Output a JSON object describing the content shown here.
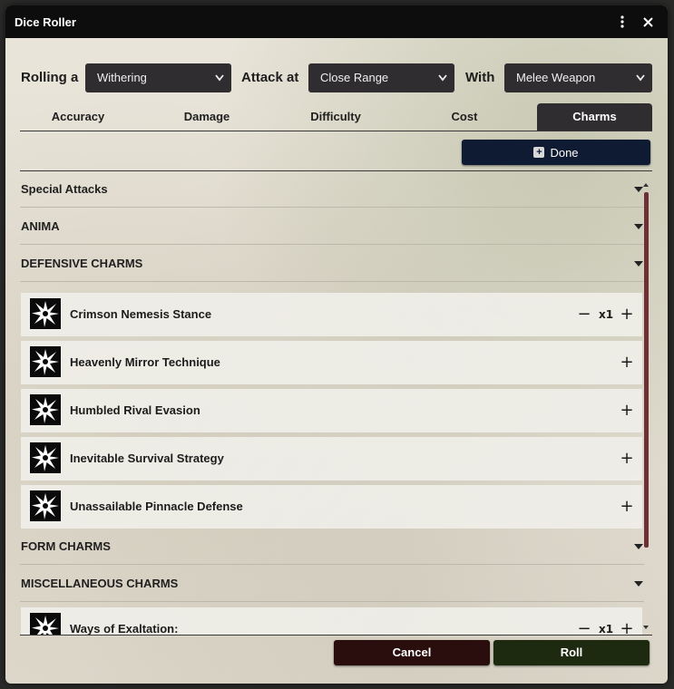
{
  "window": {
    "title": "Dice Roller"
  },
  "roll_row": {
    "rolling_label": "Rolling a",
    "rolling_value": "Withering",
    "attack_label": "Attack at",
    "attack_value": "Close Range",
    "with_label": "With",
    "with_value": "Melee Weapon"
  },
  "tabs": [
    {
      "label": "Accuracy",
      "active": false
    },
    {
      "label": "Damage",
      "active": false
    },
    {
      "label": "Difficulty",
      "active": false
    },
    {
      "label": "Cost",
      "active": false
    },
    {
      "label": "Charms",
      "active": true
    }
  ],
  "done_label": "Done",
  "sections": [
    {
      "label": "Special Attacks"
    },
    {
      "label": "ANIMA"
    },
    {
      "label": "DEFENSIVE CHARMS"
    },
    {
      "label": "FORM CHARMS"
    },
    {
      "label": "MISCELLANEOUS CHARMS"
    }
  ],
  "charms": [
    {
      "name": "Crimson Nemesis Stance",
      "qty": "x1",
      "minus": "−",
      "plus": "+"
    },
    {
      "name": "Heavenly Mirror Technique",
      "plus": "+"
    },
    {
      "name": "Humbled Rival Evasion",
      "plus": "+"
    },
    {
      "name": "Inevitable Survival Strategy",
      "plus": "+"
    },
    {
      "name": "Unassailable Pinnacle Defense",
      "plus": "+"
    },
    {
      "name": "Ways of Exaltation:",
      "qty": "x1",
      "minus": "−",
      "plus": "+"
    }
  ],
  "footer": {
    "cancel_label": "Cancel",
    "roll_label": "Roll"
  },
  "colors": {
    "dark": "#2f2d30",
    "done": "#0f1a33",
    "cancel": "#2a0e0e",
    "roll": "#1d2a10",
    "scroll": "#6e3035"
  },
  "icons": {
    "menu": "vertical-dots-icon",
    "close": "close-icon",
    "charm": "burst-icon"
  }
}
